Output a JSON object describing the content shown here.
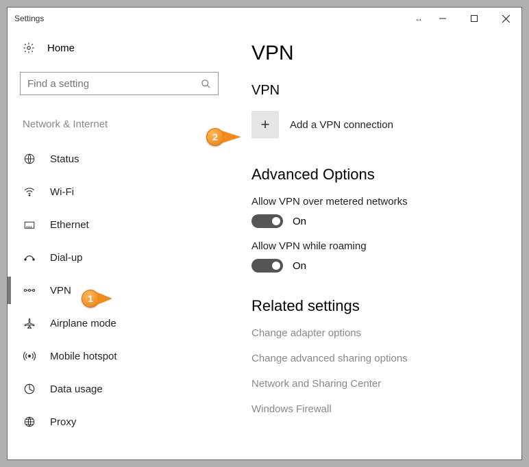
{
  "window": {
    "title": "Settings"
  },
  "sidebar": {
    "home_label": "Home",
    "search_placeholder": "Find a setting",
    "category_label": "Network & Internet",
    "items": [
      {
        "label": "Status"
      },
      {
        "label": "Wi-Fi"
      },
      {
        "label": "Ethernet"
      },
      {
        "label": "Dial-up"
      },
      {
        "label": "VPN"
      },
      {
        "label": "Airplane mode"
      },
      {
        "label": "Mobile hotspot"
      },
      {
        "label": "Data usage"
      },
      {
        "label": "Proxy"
      }
    ]
  },
  "main": {
    "title": "VPN",
    "sub": "VPN",
    "add_label": "Add a VPN connection",
    "advanced_heading": "Advanced Options",
    "settings": [
      {
        "label": "Allow VPN over metered networks",
        "state": "On"
      },
      {
        "label": "Allow VPN while roaming",
        "state": "On"
      }
    ],
    "related_heading": "Related settings",
    "links": [
      "Change adapter options",
      "Change advanced sharing options",
      "Network and Sharing Center",
      "Windows Firewall"
    ]
  },
  "callouts": {
    "one": "1",
    "two": "2"
  }
}
